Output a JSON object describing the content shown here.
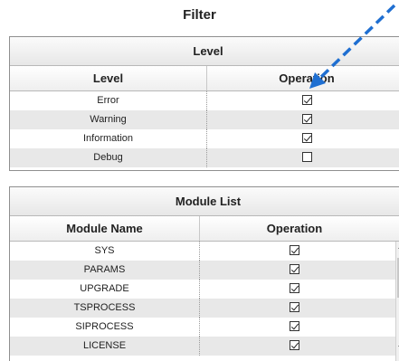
{
  "title": "Filter",
  "level_panel": {
    "header": "Level",
    "columns": [
      "Level",
      "Operation"
    ],
    "rows": [
      {
        "name": "Error",
        "checked": true
      },
      {
        "name": "Warning",
        "checked": true
      },
      {
        "name": "Information",
        "checked": true
      },
      {
        "name": "Debug",
        "checked": false
      }
    ]
  },
  "module_panel": {
    "header": "Module List",
    "columns": [
      "Module Name",
      "Operation"
    ],
    "rows": [
      {
        "name": "SYS",
        "checked": true
      },
      {
        "name": "PARAMS",
        "checked": true
      },
      {
        "name": "UPGRADE",
        "checked": true
      },
      {
        "name": "TSPROCESS",
        "checked": true
      },
      {
        "name": "SIPROCESS",
        "checked": true
      },
      {
        "name": "LICENSE",
        "checked": true
      }
    ]
  },
  "colors": {
    "annotation_arrow": "#1f6fd1",
    "alt_row": "#e8e8e8"
  }
}
